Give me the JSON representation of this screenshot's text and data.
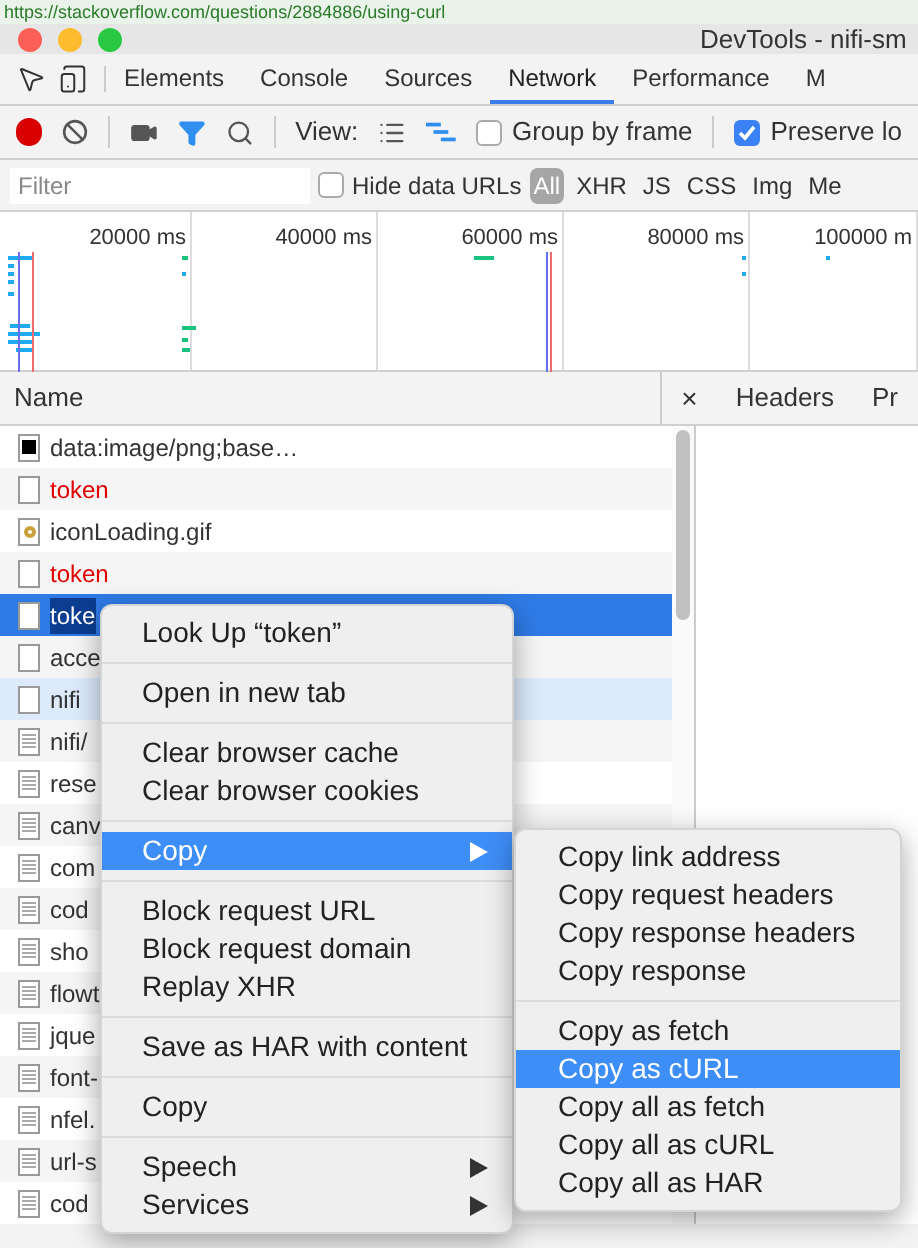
{
  "browser_url": "https://stackoverflow.com/questions/2884886/using-curl",
  "window": {
    "title": "DevTools - nifi-sm"
  },
  "tabs": [
    {
      "label": "Elements",
      "selected": false
    },
    {
      "label": "Console",
      "selected": false
    },
    {
      "label": "Sources",
      "selected": false
    },
    {
      "label": "Network",
      "selected": true
    },
    {
      "label": "Performance",
      "selected": false
    },
    {
      "label": "M",
      "selected": false
    }
  ],
  "toolbar": {
    "recording": true,
    "view_label": "View:",
    "group_by_frame": {
      "label": "Group by frame",
      "checked": false
    },
    "preserve_log": {
      "label": "Preserve lo",
      "checked": true
    }
  },
  "filter": {
    "placeholder": "Filter",
    "hide_data_urls": {
      "label": "Hide data URLs",
      "checked": false
    },
    "types": [
      {
        "label": "All",
        "selected": true
      },
      {
        "label": "XHR",
        "selected": false
      },
      {
        "label": "JS",
        "selected": false
      },
      {
        "label": "CSS",
        "selected": false
      },
      {
        "label": "Img",
        "selected": false
      },
      {
        "label": "Me",
        "selected": false
      }
    ]
  },
  "timeline": {
    "ticks": [
      "20000 ms",
      "40000 ms",
      "60000 ms",
      "80000 ms",
      "100000 m"
    ]
  },
  "requests": {
    "column": "Name",
    "rows": [
      {
        "name": "data:image/png;base…",
        "kind": "data",
        "error": false,
        "selected": false,
        "highlighted": false
      },
      {
        "name": "token",
        "kind": "blank",
        "error": true,
        "selected": false,
        "highlighted": false
      },
      {
        "name": "iconLoading.gif",
        "kind": "gif",
        "error": false,
        "selected": false,
        "highlighted": false
      },
      {
        "name": "token",
        "kind": "blank",
        "error": true,
        "selected": false,
        "highlighted": false
      },
      {
        "name": "toke",
        "kind": "blank",
        "error": false,
        "selected": true,
        "highlighted": false
      },
      {
        "name": "acce",
        "kind": "blank",
        "error": false,
        "selected": false,
        "highlighted": false
      },
      {
        "name": "nifi",
        "kind": "blank",
        "error": false,
        "selected": false,
        "highlighted": true
      },
      {
        "name": "nifi/",
        "kind": "text",
        "error": false,
        "selected": false,
        "highlighted": false
      },
      {
        "name": "rese",
        "kind": "text",
        "error": false,
        "selected": false,
        "highlighted": false
      },
      {
        "name": "canv",
        "kind": "text",
        "error": false,
        "selected": false,
        "highlighted": false
      },
      {
        "name": "com",
        "kind": "text",
        "error": false,
        "selected": false,
        "highlighted": false
      },
      {
        "name": "cod",
        "kind": "text",
        "error": false,
        "selected": false,
        "highlighted": false
      },
      {
        "name": "sho",
        "kind": "text",
        "error": false,
        "selected": false,
        "highlighted": false
      },
      {
        "name": "flowt",
        "kind": "text",
        "error": false,
        "selected": false,
        "highlighted": false
      },
      {
        "name": "jque",
        "kind": "text",
        "error": false,
        "selected": false,
        "highlighted": false
      },
      {
        "name": "font-",
        "kind": "text",
        "error": false,
        "selected": false,
        "highlighted": false
      },
      {
        "name": "nfel.",
        "kind": "text",
        "error": false,
        "selected": false,
        "highlighted": false
      },
      {
        "name": "url-s",
        "kind": "text",
        "error": false,
        "selected": false,
        "highlighted": false
      },
      {
        "name": "cod",
        "kind": "text",
        "error": false,
        "selected": false,
        "highlighted": false
      }
    ]
  },
  "details": {
    "close": "×",
    "tabs": [
      "Headers",
      "Pr"
    ]
  },
  "context_menu": {
    "groups": [
      [
        {
          "label": "Look Up “token”",
          "submenu": false,
          "selected": false
        }
      ],
      [
        {
          "label": "Open in new tab",
          "submenu": false,
          "selected": false
        }
      ],
      [
        {
          "label": "Clear browser cache",
          "submenu": false,
          "selected": false
        },
        {
          "label": "Clear browser cookies",
          "submenu": false,
          "selected": false
        }
      ],
      [
        {
          "label": "Copy",
          "submenu": true,
          "selected": true
        }
      ],
      [
        {
          "label": "Block request URL",
          "submenu": false,
          "selected": false
        },
        {
          "label": "Block request domain",
          "submenu": false,
          "selected": false
        },
        {
          "label": "Replay XHR",
          "submenu": false,
          "selected": false
        }
      ],
      [
        {
          "label": "Save as HAR with content",
          "submenu": false,
          "selected": false
        }
      ],
      [
        {
          "label": "Copy",
          "submenu": false,
          "selected": false
        }
      ],
      [
        {
          "label": "Speech",
          "submenu": true,
          "selected": false
        },
        {
          "label": "Services",
          "submenu": true,
          "selected": false
        }
      ]
    ]
  },
  "submenu": {
    "groups": [
      [
        {
          "label": "Copy link address",
          "selected": false
        },
        {
          "label": "Copy request headers",
          "selected": false
        },
        {
          "label": "Copy response headers",
          "selected": false
        },
        {
          "label": "Copy response",
          "selected": false
        }
      ],
      [
        {
          "label": "Copy as fetch",
          "selected": false
        },
        {
          "label": "Copy as cURL",
          "selected": true
        },
        {
          "label": "Copy all as fetch",
          "selected": false
        },
        {
          "label": "Copy all as cURL",
          "selected": false
        },
        {
          "label": "Copy all as HAR",
          "selected": false
        }
      ]
    ]
  }
}
